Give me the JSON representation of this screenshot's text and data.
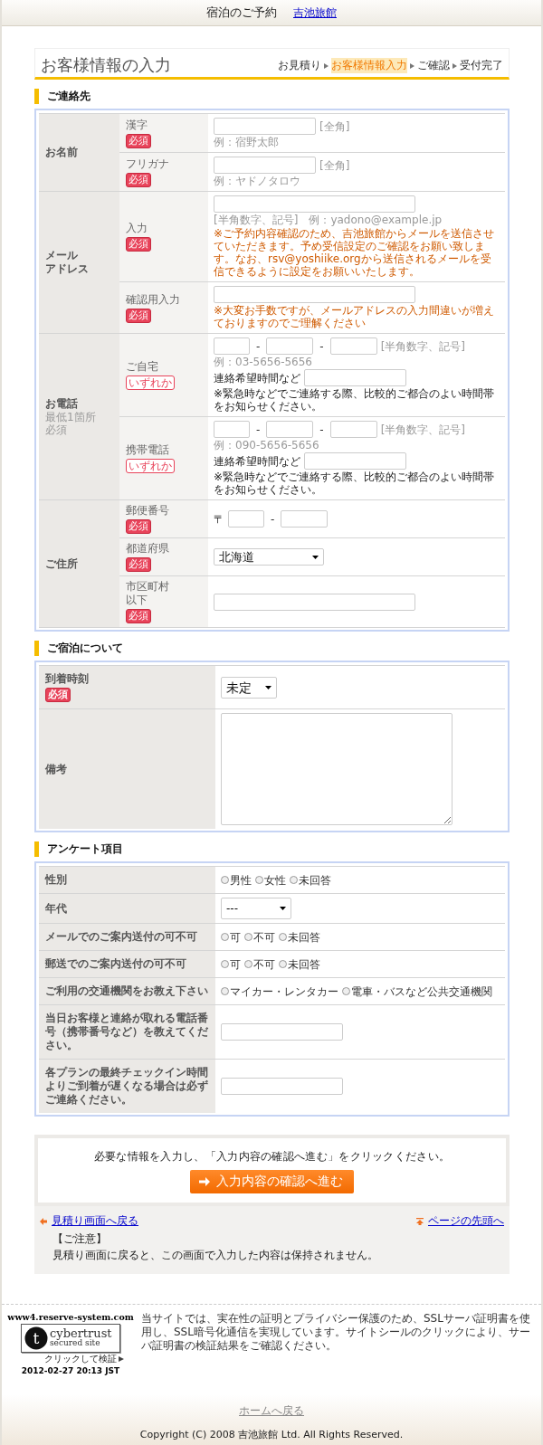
{
  "header": {
    "title": "宿泊のご予約",
    "link": "吉池旅館"
  },
  "page_title": "お客様情報の入力",
  "steps": [
    {
      "label": "お見積り",
      "selected": false
    },
    {
      "label": "お客様情報入力",
      "selected": true
    },
    {
      "label": "ご確認",
      "selected": false
    },
    {
      "label": "受付完了",
      "selected": false
    }
  ],
  "sections": [
    {
      "heading": "ご連絡先",
      "groups": [
        {
          "label": "お名前",
          "rows": [
            {
              "kind": "name",
              "label": "漢字",
              "badge": {
                "kind": "required",
                "text": "必須"
              },
              "hint": "[全角]",
              "example": "例：宿野太郎"
            },
            {
              "kind": "name",
              "label": "フリガナ",
              "badge": {
                "kind": "required",
                "text": "必須"
              },
              "hint": "[全角]",
              "example": "例：ヤドノタロウ"
            }
          ]
        },
        {
          "label": [
            "メール",
            "アドレス"
          ],
          "rows": [
            {
              "kind": "email",
              "label": "入力",
              "badge": {
                "kind": "required",
                "text": "必須"
              },
              "hint": "[半角数字、記号]",
              "example": "例：yadono@example.jp",
              "note": "※ご予約内容確認のため、吉池旅館からメールを送信させていただきます。予め受信設定のご確認をお願い致します。なお、rsv@yoshiike.orgから送信されるメールを受信できるように設定をお願いいたします。"
            },
            {
              "kind": "email",
              "label": "確認用入力",
              "badge": {
                "kind": "required",
                "text": "必須"
              },
              "note": "※大変お手数ですが、メールアドレスの入力間違いが増えておりますのでご理解ください"
            }
          ]
        },
        {
          "label": "お電話",
          "sublabel": [
            "最低1箇所",
            "必須"
          ],
          "rows": [
            {
              "kind": "phone",
              "label": "ご自宅",
              "badge": {
                "kind": "either",
                "text": "いずれか"
              },
              "separators": [
                "-",
                "-"
              ],
              "hint": "[半角数字、記号]",
              "example": "例：03-5656-5656",
              "time_label": "連絡希望時間など",
              "note": "※緊急時などでご連絡する際、比較的ご都合のよい時間帯をお知らせください。"
            },
            {
              "kind": "phone",
              "label": "携帯電話",
              "badge": {
                "kind": "either",
                "text": "いずれか"
              },
              "separators": [
                "-",
                "-"
              ],
              "hint": "[半角数字、記号]",
              "example": "例：090-5656-5656",
              "time_label": "連絡希望時間など",
              "note": "※緊急時などでご連絡する際、比較的ご都合のよい時間帯をお知らせください。"
            }
          ]
        },
        {
          "label": "ご住所",
          "rows": [
            {
              "kind": "zip",
              "label": "郵便番号",
              "badge": {
                "kind": "required",
                "text": "必須"
              },
              "prefix": "〒",
              "separators": [
                "-"
              ]
            },
            {
              "kind": "select",
              "label": "都道府県",
              "badge": {
                "kind": "required",
                "text": "必須"
              },
              "value": "北海道"
            },
            {
              "kind": "address",
              "label": [
                "市区町村",
                "以下"
              ],
              "badge": {
                "kind": "required",
                "text": "必須"
              }
            }
          ]
        }
      ]
    },
    {
      "heading": "ご宿泊について",
      "rows": [
        {
          "kind": "select",
          "label": "到着時刻",
          "badge": {
            "kind": "required",
            "text": "必須"
          },
          "value": "未定"
        },
        {
          "kind": "textarea",
          "label": "備考"
        }
      ]
    },
    {
      "heading": "アンケート項目",
      "rows": [
        {
          "kind": "radio",
          "label": "性別",
          "options": [
            {
              "label": "男性",
              "selected": false
            },
            {
              "label": "女性",
              "selected": false
            },
            {
              "label": "未回答",
              "selected": false
            }
          ]
        },
        {
          "kind": "select",
          "label": "年代",
          "value": "---"
        },
        {
          "kind": "radio",
          "label": "メールでのご案内送付の可不可",
          "options": [
            {
              "label": "可",
              "selected": false
            },
            {
              "label": "不可",
              "selected": false
            },
            {
              "label": "未回答",
              "selected": false
            }
          ]
        },
        {
          "kind": "radio",
          "label": "郵送でのご案内送付の可不可",
          "options": [
            {
              "label": "可",
              "selected": false
            },
            {
              "label": "不可",
              "selected": false
            },
            {
              "label": "未回答",
              "selected": false
            }
          ]
        },
        {
          "kind": "radio",
          "label": "ご利用の交通機関をお教え下さい",
          "options": [
            {
              "label": "マイカー・レンタカー",
              "selected": false
            },
            {
              "label": "電車・バスなど公共交通機関",
              "selected": false
            }
          ]
        },
        {
          "kind": "text",
          "label": "当日お客様と連絡が取れる電話番号（携帯番号など）を教えてください。"
        },
        {
          "kind": "text",
          "label": "各プランの最終チェックイン時間よりご到着が遅くなる場合は必ずご連絡ください。"
        }
      ]
    }
  ],
  "submit": {
    "instruction": "必要な情報を入力し、「入力内容の確認へ進む」をクリックください。",
    "button": "入力内容の確認へ進む"
  },
  "nav": {
    "back_link": "見積り画面へ戻る",
    "top_link": "ページの先頭へ",
    "notice_title": "【ご注意】",
    "notice": "見積り画面に戻ると、この画面で入力した内容は保持されません。"
  },
  "footer": {
    "seal": {
      "site": "www4.reserve-system.com",
      "mark": "t",
      "brand": "cybertrust",
      "tagline": "secured site",
      "verify": "クリックして検証",
      "date": "2012-02-27 20:13 JST"
    },
    "ssl_text": "当サイトでは、実在性の証明とプライバシー保護のため、SSLサーバ証明書を使用し、SSL暗号化通信を実現しています。サイトシールのクリックにより、サーバ証明書の検証結果をご確認ください。",
    "home_link": "ホームへ戻る",
    "copyright": "Copyright (C) 2008 吉池旅館 Ltd. All Rights Reserved."
  }
}
